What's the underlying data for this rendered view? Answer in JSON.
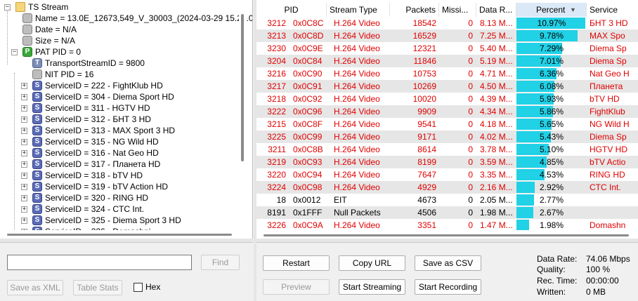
{
  "tree": {
    "root": "TS Stream",
    "fields": [
      {
        "icon": "gray-box-icon",
        "label": "Name = 13.0E_12673,549_V_30003_(2024-03-29 15.20.0"
      },
      {
        "icon": "gray-box-icon",
        "label": "Date = N/A"
      },
      {
        "icon": "gray-box-icon",
        "label": "Size = N/A"
      }
    ],
    "pat": {
      "badge": "P",
      "label": "PAT PID = 0"
    },
    "pat_children": [
      {
        "badge": "T",
        "label": "TransportStreamID = 9800"
      },
      {
        "badge": "",
        "label": "NIT PID = 16"
      }
    ],
    "services": [
      {
        "badge": "S",
        "label": "ServiceID = 222 - FightKlub HD"
      },
      {
        "badge": "S",
        "label": "ServiceID = 304 - Diema Sport HD"
      },
      {
        "badge": "S",
        "label": "ServiceID = 311 - HGTV HD"
      },
      {
        "badge": "S",
        "label": "ServiceID = 312 - БНТ 3 HD"
      },
      {
        "badge": "S",
        "label": "ServiceID = 313 - MAX Sport 3 HD"
      },
      {
        "badge": "S",
        "label": "ServiceID = 315 - NG Wild HD"
      },
      {
        "badge": "S",
        "label": "ServiceID = 316 - Nat Geo HD"
      },
      {
        "badge": "S",
        "label": "ServiceID = 317 - Планета HD"
      },
      {
        "badge": "S",
        "label": "ServiceID = 318 - bTV HD"
      },
      {
        "badge": "S",
        "label": "ServiceID = 319 - bTV Action HD"
      },
      {
        "badge": "S",
        "label": "ServiceID = 320 - RING HD"
      },
      {
        "badge": "S",
        "label": "ServiceID = 324 - CTC Int."
      },
      {
        "badge": "S",
        "label": "ServiceID = 325 - Diema Sport 3 HD"
      },
      {
        "badge": "S",
        "label": "ServiceID = 326 - Domashni..."
      }
    ]
  },
  "left_controls": {
    "find_value": "",
    "find_label": "Find",
    "save_xml_label": "Save as XML",
    "table_stats_label": "Table Stats",
    "hex_label": "Hex",
    "hex_checked": false
  },
  "table": {
    "columns": [
      "PID",
      "Stream Type",
      "Packets",
      "Missi...",
      "Data R...",
      "Percent",
      "Service"
    ],
    "sorted_column": "Percent",
    "rows": [
      {
        "pid_dec": "3212",
        "pid_hex": "0x0C8C",
        "type": "H.264 Video",
        "packets": "18542",
        "missing": "0",
        "rate": "8.13 M...",
        "percent": 10.97,
        "percent_text": "10.97%",
        "service": "БНТ 3 HD",
        "color": "red"
      },
      {
        "pid_dec": "3213",
        "pid_hex": "0x0C8D",
        "type": "H.264 Video",
        "packets": "16529",
        "missing": "0",
        "rate": "7.25 M...",
        "percent": 9.78,
        "percent_text": "9.78%",
        "service": "MAX Spo",
        "color": "red"
      },
      {
        "pid_dec": "3230",
        "pid_hex": "0x0C9E",
        "type": "H.264 Video",
        "packets": "12321",
        "missing": "0",
        "rate": "5.40 M...",
        "percent": 7.29,
        "percent_text": "7.29%",
        "service": "Diema Sp",
        "color": "red"
      },
      {
        "pid_dec": "3204",
        "pid_hex": "0x0C84",
        "type": "H.264 Video",
        "packets": "11846",
        "missing": "0",
        "rate": "5.19 M...",
        "percent": 7.01,
        "percent_text": "7.01%",
        "service": "Diema Sp",
        "color": "red"
      },
      {
        "pid_dec": "3216",
        "pid_hex": "0x0C90",
        "type": "H.264 Video",
        "packets": "10753",
        "missing": "0",
        "rate": "4.71 M...",
        "percent": 6.36,
        "percent_text": "6.36%",
        "service": "Nat Geo H",
        "color": "red"
      },
      {
        "pid_dec": "3217",
        "pid_hex": "0x0C91",
        "type": "H.264 Video",
        "packets": "10269",
        "missing": "0",
        "rate": "4.50 M...",
        "percent": 6.08,
        "percent_text": "6.08%",
        "service": "Планета",
        "color": "red"
      },
      {
        "pid_dec": "3218",
        "pid_hex": "0x0C92",
        "type": "H.264 Video",
        "packets": "10020",
        "missing": "0",
        "rate": "4.39 M...",
        "percent": 5.93,
        "percent_text": "5.93%",
        "service": "bTV HD",
        "color": "red"
      },
      {
        "pid_dec": "3222",
        "pid_hex": "0x0C96",
        "type": "H.264 Video",
        "packets": "9909",
        "missing": "0",
        "rate": "4.34 M...",
        "percent": 5.86,
        "percent_text": "5.86%",
        "service": "FightKlub",
        "color": "red"
      },
      {
        "pid_dec": "3215",
        "pid_hex": "0x0C8F",
        "type": "H.264 Video",
        "packets": "9541",
        "missing": "0",
        "rate": "4.18 M...",
        "percent": 5.65,
        "percent_text": "5.65%",
        "service": "NG Wild H",
        "color": "red"
      },
      {
        "pid_dec": "3225",
        "pid_hex": "0x0C99",
        "type": "H.264 Video",
        "packets": "9171",
        "missing": "0",
        "rate": "4.02 M...",
        "percent": 5.43,
        "percent_text": "5.43%",
        "service": "Diema Sp",
        "color": "red"
      },
      {
        "pid_dec": "3211",
        "pid_hex": "0x0C8B",
        "type": "H.264 Video",
        "packets": "8614",
        "missing": "0",
        "rate": "3.78 M...",
        "percent": 5.1,
        "percent_text": "5.10%",
        "service": "HGTV HD",
        "color": "red"
      },
      {
        "pid_dec": "3219",
        "pid_hex": "0x0C93",
        "type": "H.264 Video",
        "packets": "8199",
        "missing": "0",
        "rate": "3.59 M...",
        "percent": 4.85,
        "percent_text": "4.85%",
        "service": "bTV Actio",
        "color": "red"
      },
      {
        "pid_dec": "3220",
        "pid_hex": "0x0C94",
        "type": "H.264 Video",
        "packets": "7647",
        "missing": "0",
        "rate": "3.35 M...",
        "percent": 4.53,
        "percent_text": "4.53%",
        "service": "RING HD",
        "color": "red"
      },
      {
        "pid_dec": "3224",
        "pid_hex": "0x0C98",
        "type": "H.264 Video",
        "packets": "4929",
        "missing": "0",
        "rate": "2.16 M...",
        "percent": 2.92,
        "percent_text": "2.92%",
        "service": "CTC Int.",
        "color": "red"
      },
      {
        "pid_dec": "18",
        "pid_hex": "0x0012",
        "type": "EIT",
        "packets": "4673",
        "missing": "0",
        "rate": "2.05 M...",
        "percent": 2.77,
        "percent_text": "2.77%",
        "service": "",
        "color": "black"
      },
      {
        "pid_dec": "8191",
        "pid_hex": "0x1FFF",
        "type": "Null Packets",
        "packets": "4506",
        "missing": "0",
        "rate": "1.98 M...",
        "percent": 2.67,
        "percent_text": "2.67%",
        "service": "",
        "color": "black"
      },
      {
        "pid_dec": "3226",
        "pid_hex": "0x0C9A",
        "type": "H.264 Video",
        "packets": "3351",
        "missing": "0",
        "rate": "1.47 M...",
        "percent": 1.98,
        "percent_text": "1.98%",
        "service": "Domashn",
        "color": "red"
      }
    ]
  },
  "right_controls": {
    "restart_label": "Restart",
    "copy_url_label": "Copy URL",
    "save_csv_label": "Save as CSV",
    "preview_label": "Preview",
    "start_streaming_label": "Start Streaming",
    "start_recording_label": "Start Recording"
  },
  "stats": {
    "data_rate_label": "Data Rate:",
    "data_rate_value": "74.06 Mbps",
    "quality_label": "Quality:",
    "quality_value": "100 %",
    "rec_time_label": "Rec. Time:",
    "rec_time_value": "00:00:00",
    "written_label": "Written:",
    "written_value": "0 MB"
  },
  "colors": {
    "bar": "#21d1e6",
    "video_text": "#e00000",
    "alt_row": "#e6e6e6"
  }
}
